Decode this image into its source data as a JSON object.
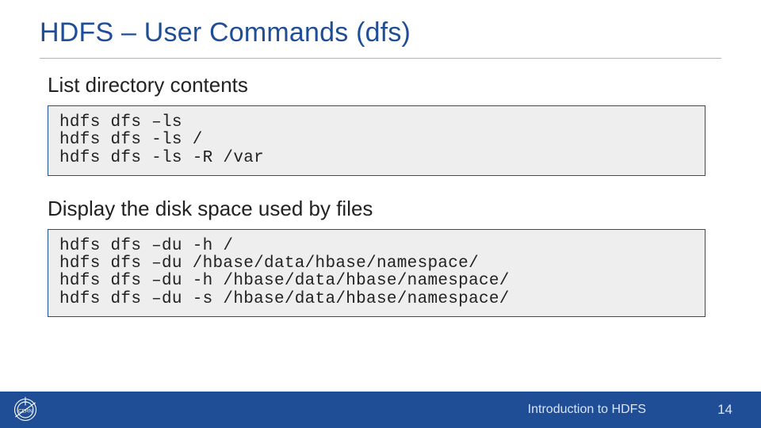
{
  "title": "HDFS – User Commands (dfs)",
  "sections": [
    {
      "heading": "List directory contents",
      "code": "hdfs dfs –ls\nhdfs dfs -ls /\nhdfs dfs -ls -R /var"
    },
    {
      "heading": "Display the disk space used by files",
      "code": "hdfs dfs –du -h /\nhdfs dfs –du /hbase/data/hbase/namespace/\nhdfs dfs –du -h /hbase/data/hbase/namespace/\nhdfs dfs –du -s /hbase/data/hbase/namespace/"
    }
  ],
  "footer": {
    "text": "Introduction to HDFS",
    "page": "14",
    "logo": "cern-logo"
  },
  "colors": {
    "accent": "#1f4e96",
    "code_bg": "#eeeeee"
  }
}
